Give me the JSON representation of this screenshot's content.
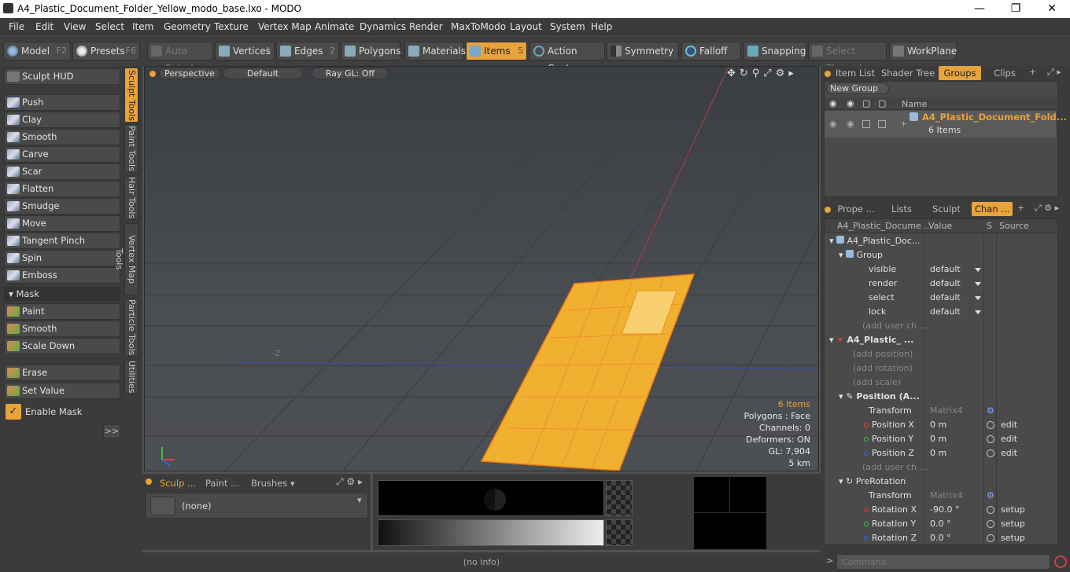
{
  "window": {
    "title": "A4_Plastic_Document_Folder_Yellow_modo_base.lxo - MODO"
  },
  "menu": [
    "File",
    "Edit",
    "View",
    "Select",
    "Item",
    "Geometry",
    "Texture",
    "Vertex Map",
    "Animate",
    "Dynamics",
    "Render",
    "MaxToModo",
    "Layout",
    "System",
    "Help"
  ],
  "toolbar": {
    "model": "Model",
    "model_key": "F2",
    "presets": "Presets",
    "presets_key": "F6",
    "auto_select": "Auto Select",
    "vertices": "Vertices",
    "vertices_key": "1",
    "edges": "Edges",
    "edges_key": "2",
    "polygons": "Polygons",
    "materials": "Materials",
    "items": "Items",
    "items_key": "5",
    "action_center": "Action Center",
    "symmetry": "Symmetry",
    "falloff": "Falloff",
    "snapping": "Snapping",
    "select_through": "Select Through",
    "workplane": "WorkPlane"
  },
  "left": {
    "sculpt_hud": "Sculpt HUD",
    "tools": [
      "Push",
      "Clay",
      "Smooth",
      "Carve",
      "Scar",
      "Flatten",
      "Smudge",
      "Move",
      "Tangent Pinch",
      "Spin",
      "Emboss"
    ],
    "mask_header": "Mask",
    "mask_tools": [
      "Paint",
      "Smooth",
      "Scale Down"
    ],
    "erase": "Erase",
    "set_value": "Set Value",
    "enable_mask": "Enable Mask",
    "expand": ">>",
    "vtabs": [
      "Sculpt Tools",
      "Paint Tools",
      "Hair Tools",
      "Vertex Map Tools",
      "Particle Tools",
      "Utilities"
    ]
  },
  "viewport": {
    "perspective": "Perspective",
    "shading": "Default",
    "raygl": "Ray GL: Off",
    "axis_label": "-Z",
    "info": {
      "items": "6 Items",
      "polygons": "Polygons : Face",
      "channels": "Channels: 0",
      "deformers": "Deformers: ON",
      "gl": "GL: 7,904",
      "scale": "5 km"
    }
  },
  "bottom": {
    "tabs": [
      "Sculp ...",
      "Paint ...",
      "Brushes"
    ],
    "brush": "(none)"
  },
  "groups_panel": {
    "tabs": [
      "Item List",
      "Shader Tree",
      "Groups",
      "Clips"
    ],
    "new_group": "New Group",
    "col_name": "Name",
    "group_name": "A4_Plastic_Document_Fold...",
    "group_count": "6 Items"
  },
  "channels_panel": {
    "tabs": [
      "Prope ...",
      "Lists",
      "Sculpt",
      "Chan ..."
    ],
    "headers": {
      "name": "A4_Plastic_Docume ...",
      "value": "Value",
      "s": "S",
      "source": "Source"
    },
    "rows": [
      {
        "label": "A4_Plastic_Doc...",
        "value": "",
        "source": ""
      },
      {
        "label": "Group",
        "value": "",
        "source": ""
      },
      {
        "label": "visible",
        "value": "default",
        "source": ""
      },
      {
        "label": "render",
        "value": "default",
        "source": ""
      },
      {
        "label": "select",
        "value": "default",
        "source": ""
      },
      {
        "label": "lock",
        "value": "default",
        "source": ""
      },
      {
        "label": "(add user ch ...",
        "value": "",
        "source": ""
      },
      {
        "label": "A4_Plastic_ ...",
        "value": "",
        "source": ""
      },
      {
        "label": "(add position)",
        "value": "",
        "source": ""
      },
      {
        "label": "(add rotation)",
        "value": "",
        "source": ""
      },
      {
        "label": "(add scale)",
        "value": "",
        "source": ""
      },
      {
        "label": "Position (A...",
        "value": "",
        "source": ""
      },
      {
        "label": "Transform",
        "value": "Matrix4",
        "source": ""
      },
      {
        "label": "Position X",
        "value": "0 m",
        "source": "edit"
      },
      {
        "label": "Position Y",
        "value": "0 m",
        "source": "edit"
      },
      {
        "label": "Position Z",
        "value": "0 m",
        "source": "edit"
      },
      {
        "label": "(add user ch ...",
        "value": "",
        "source": ""
      },
      {
        "label": "PreRotation",
        "value": "",
        "source": ""
      },
      {
        "label": "Transform",
        "value": "Matrix4",
        "source": ""
      },
      {
        "label": "Rotation X",
        "value": "-90.0 °",
        "source": "setup"
      },
      {
        "label": "Rotation Y",
        "value": "0.0 °",
        "source": "setup"
      },
      {
        "label": "Rotation Z",
        "value": "0.0 °",
        "source": "setup"
      }
    ]
  },
  "status": {
    "info": "(no info)",
    "command_placeholder": "Command"
  },
  "colors": {
    "accent": "#e8a33a",
    "panel": "#3b3b3b",
    "x_axis": "#e04040",
    "y_axis": "#40c040",
    "z_axis": "#4060e0"
  }
}
